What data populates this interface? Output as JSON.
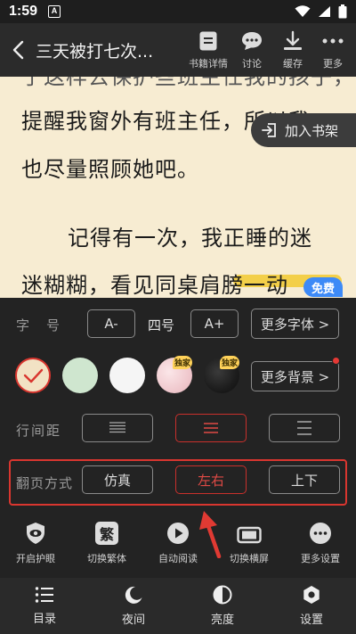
{
  "status": {
    "time": "1:59",
    "app_letter": "A"
  },
  "header": {
    "book_title": "三天被打七次...",
    "actions": [
      {
        "label": "书籍详情",
        "icon": "book-detail-icon"
      },
      {
        "label": "讨论",
        "icon": "chat-icon"
      },
      {
        "label": "缓存",
        "icon": "download-icon"
      },
      {
        "label": "更多",
        "icon": "more-dots-icon"
      }
    ]
  },
  "reading": {
    "lines": [
      "了这样去保护些班主任我的孩子，",
      "提醒我窗外有班主任，所以我",
      "也尽量照顾她吧。",
      "记得有一次，我正睡的迷",
      "迷糊糊，看见同桌肩膀一动"
    ],
    "add_shelf_label": "加入书架",
    "free_badge": "免费"
  },
  "settings": {
    "font": {
      "label": "字　号",
      "decrease": "A-",
      "current": "四号",
      "increase": "A+",
      "more": "更多字体 >"
    },
    "background": {
      "exclusive_badge": "独家",
      "more": "更多背景 >",
      "colors": [
        "#f2e2c4",
        "#cfe6cf",
        "#f5f5f5",
        "#f3d5d8",
        "#1c1c1c"
      ],
      "selected_index": 0
    },
    "line_spacing": {
      "label": "行间距"
    },
    "page_turn": {
      "label": "翻页方式",
      "options": [
        "仿真",
        "左右",
        "上下"
      ],
      "selected": "左右"
    }
  },
  "tools": [
    {
      "label": "开启护眼",
      "icon": "eye-shield-icon"
    },
    {
      "label": "切换繁体",
      "icon": "traditional-chinese-icon",
      "glyph": "繁"
    },
    {
      "label": "自动阅读",
      "icon": "play-icon"
    },
    {
      "label": "切换横屏",
      "icon": "landscape-icon"
    },
    {
      "label": "更多设置",
      "icon": "more-settings-icon"
    }
  ],
  "bottom_nav": [
    {
      "label": "目录",
      "icon": "catalog-icon"
    },
    {
      "label": "夜间",
      "icon": "moon-icon"
    },
    {
      "label": "亮度",
      "icon": "brightness-icon"
    },
    {
      "label": "设置",
      "icon": "gear-icon"
    }
  ],
  "colors": {
    "accent_red": "#d9362f",
    "paper": "#f7ecd2",
    "highlight": "#f3cf49",
    "free_blue": "#3d8af7"
  }
}
